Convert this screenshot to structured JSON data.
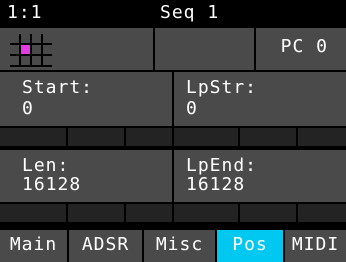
{
  "header": {
    "position": "1:1",
    "sequence": "Seq 1"
  },
  "top_row": {
    "grid": {
      "rows": 3,
      "cols": 4,
      "active_cell": {
        "row": 1,
        "col": 1
      },
      "active_color": "#e43be4"
    },
    "pc_label": "PC 0"
  },
  "params": {
    "start": {
      "label": "Start:",
      "value": "0"
    },
    "lpstr": {
      "label": "LpStr:",
      "value": "0"
    },
    "len": {
      "label": "Len:",
      "value": "16128"
    },
    "lpend": {
      "label": "LpEnd:",
      "value": "16128"
    }
  },
  "tabs": [
    {
      "label": "Main",
      "active": false
    },
    {
      "label": "ADSR",
      "active": false
    },
    {
      "label": "Misc",
      "active": false
    },
    {
      "label": "Pos",
      "active": true
    },
    {
      "label": "MIDI",
      "active": false
    }
  ],
  "colors": {
    "background": "#000000",
    "panel": "#4a4a4a",
    "separator": "#232323",
    "active_tab": "#00c8f0",
    "text": "#ffffff"
  }
}
